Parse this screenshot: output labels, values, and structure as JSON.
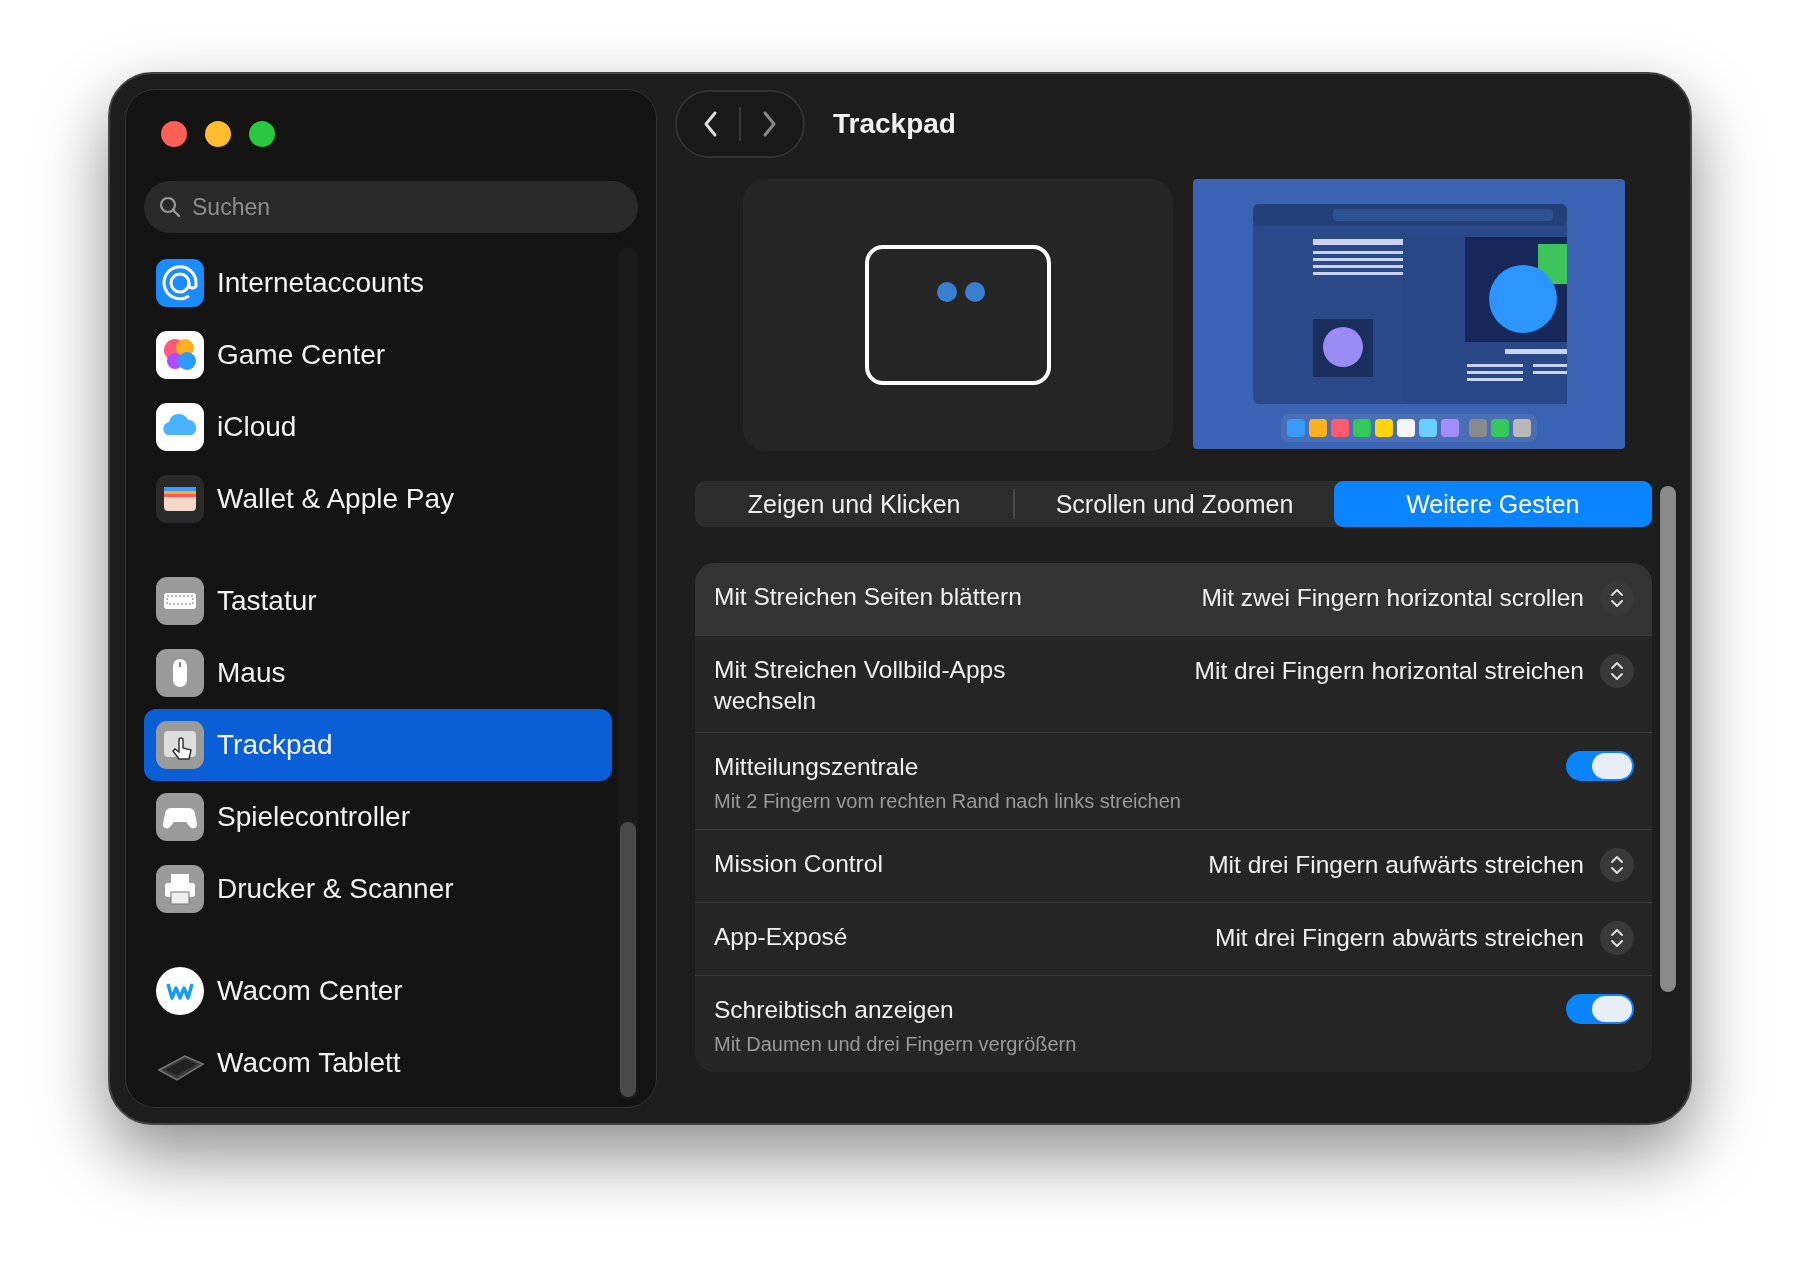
{
  "window": {
    "title": "Trackpad"
  },
  "sidebar": {
    "search": {
      "placeholder": "Suchen"
    },
    "groups": [
      {
        "items": [
          {
            "label": "Internetaccounts",
            "selected": false
          },
          {
            "label": "Game Center",
            "selected": false
          },
          {
            "label": "iCloud",
            "selected": false
          },
          {
            "label": "Wallet & Apple Pay",
            "selected": false
          }
        ]
      },
      {
        "items": [
          {
            "label": "Tastatur",
            "selected": false
          },
          {
            "label": "Maus",
            "selected": false
          },
          {
            "label": "Trackpad",
            "selected": true
          },
          {
            "label": "Spielecontroller",
            "selected": false
          },
          {
            "label": "Drucker & Scanner",
            "selected": false
          }
        ]
      },
      {
        "items": [
          {
            "label": "Wacom Center",
            "selected": false
          },
          {
            "label": "Wacom Tablett",
            "selected": false
          }
        ]
      }
    ]
  },
  "tabs": [
    {
      "label": "Zeigen und Klicken",
      "selected": false
    },
    {
      "label": "Scrollen und Zoomen",
      "selected": false
    },
    {
      "label": "Weitere Gesten",
      "selected": true
    }
  ],
  "settings": [
    {
      "kind": "popup",
      "label": "Mit Streichen Seiten blättern",
      "value": "Mit zwei Fingern horizontal scrollen",
      "selected": true
    },
    {
      "kind": "popup",
      "label": "Mit Streichen Vollbild-Apps wechseln",
      "value": "Mit drei Fingern horizontal streichen",
      "selected": false
    },
    {
      "kind": "toggle",
      "label": "Mitteilungszentrale",
      "description": "Mit 2 Fingern vom rechten Rand nach links streichen",
      "on": true,
      "selected": false
    },
    {
      "kind": "popup",
      "label": "Mission Control",
      "value": "Mit drei Fingern aufwärts streichen",
      "selected": false
    },
    {
      "kind": "popup",
      "label": "App-Exposé",
      "value": "Mit drei Fingern abwärts streichen",
      "selected": false
    },
    {
      "kind": "toggle",
      "label": "Schreibtisch anzeigen",
      "description": "Mit Daumen und drei Fingern vergrößern",
      "on": true,
      "selected": false
    }
  ]
}
